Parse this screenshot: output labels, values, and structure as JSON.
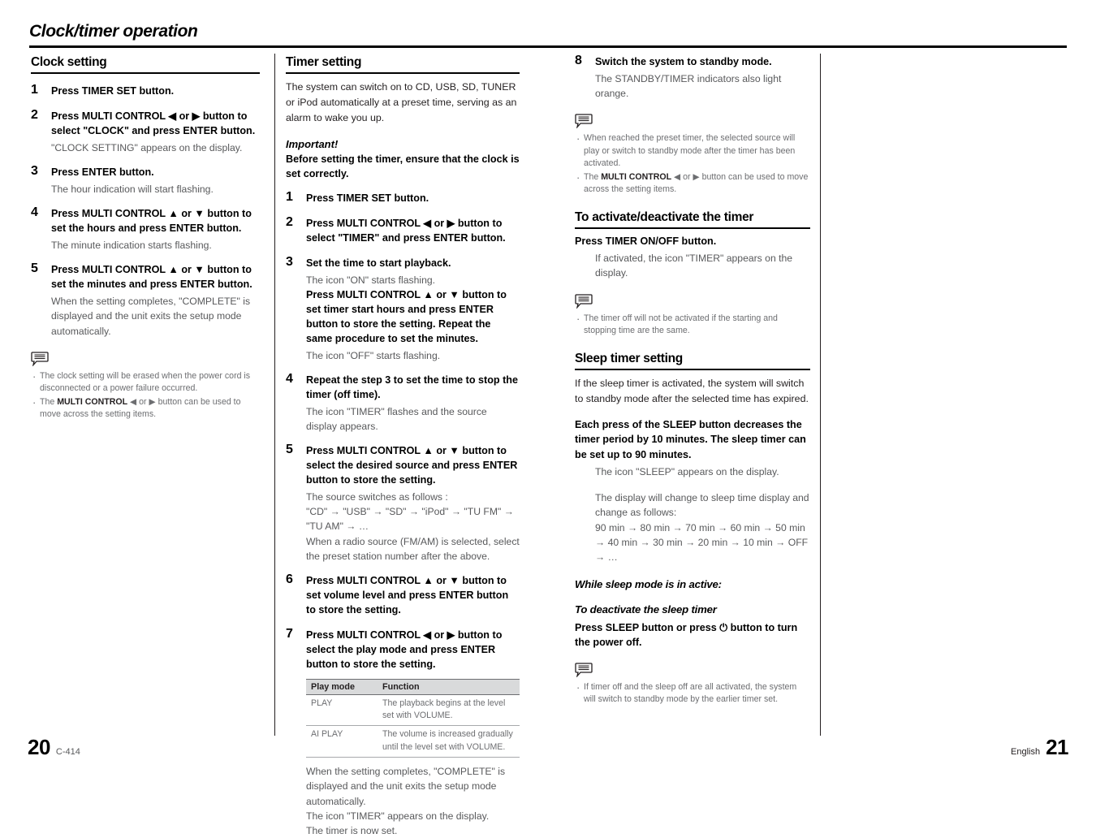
{
  "running_head": "Clock/timer operation",
  "footer": {
    "left_page": "20",
    "model": "C-414",
    "language": "English",
    "right_page": "21"
  },
  "left_column": {
    "heading": "Clock setting",
    "steps": [
      {
        "num": "1",
        "title": "Press TIMER SET button.",
        "body": ""
      },
      {
        "num": "2",
        "title": "Press MULTI CONTROL ◀ or ▶ button to select \"CLOCK\" and press ENTER button.",
        "body": "\"CLOCK SETTING\" appears on the display."
      },
      {
        "num": "3",
        "title": "Press ENTER button.",
        "body": "The hour indication will start flashing."
      },
      {
        "num": "4",
        "title": "Press MULTI CONTROL ▲ or ▼ button to set the hours and press ENTER button.",
        "body": "The minute indication starts flashing."
      },
      {
        "num": "5",
        "title": "Press MULTI CONTROL ▲ or ▼ button to set the minutes and press ENTER button.",
        "body": "When the setting completes, \"COMPLETE\" is displayed and the unit exits the setup mode automatically."
      }
    ],
    "notes": [
      "The clock setting will be erased when the power cord is disconnected or a power failure occurred.",
      "The MULTI CONTROL ◀ or ▶ button can be used to move across the setting items."
    ],
    "note2_prefix": "The ",
    "note2_bold": "MULTI CONTROL",
    "note2_mid": " ◀ or ▶ ",
    "note2_suffix": "button can be used to move across the setting items."
  },
  "middle_column": {
    "heading": "Timer setting",
    "intro": "The system can switch on to CD, USB, SD, TUNER or iPod automatically at a preset time, serving as an alarm to wake you up.",
    "important_label": "Important!",
    "important_text": "Before setting the timer, ensure that the clock is set correctly.",
    "steps": [
      {
        "num": "1",
        "title": "Press TIMER SET button.",
        "body": ""
      },
      {
        "num": "2",
        "title": "Press MULTI CONTROL ◀ or ▶ button to select \"TIMER\" and press ENTER button.",
        "body": ""
      },
      {
        "num": "3",
        "title": "Set the time to start playback.",
        "body": "The icon \"ON\" starts flashing.",
        "sub_bold": "Press MULTI CONTROL ▲ or ▼ button to set timer start hours and press ENTER button to store the setting. Repeat the same procedure to set the minutes.",
        "body2": "The icon \"OFF\" starts flashing."
      },
      {
        "num": "4",
        "title": "Repeat the step 3 to set the time to stop the timer (off time).",
        "body": "The icon \"TIMER\" flashes and the source display appears."
      },
      {
        "num": "5",
        "title": "Press MULTI CONTROL ▲ or ▼ button to select the desired source and press ENTER button to store the setting.",
        "body": "The source switches as follows :",
        "body_line2": "\"CD\" → \"USB\" →  \"SD\" → \"iPod\" → \"TU FM\" → \"TU AM\" → …",
        "body_line3": "When a radio source (FM/AM) is selected, select the preset station number after the above."
      },
      {
        "num": "6",
        "title": "Press MULTI CONTROL ▲ or ▼ button to set volume level and press ENTER button to store the setting.",
        "body": ""
      },
      {
        "num": "7",
        "title": "Press MULTI CONTROL ◀ or ▶ button to select the play mode and press ENTER button to store the setting.",
        "body": ""
      }
    ],
    "table": {
      "headers": [
        "Play mode",
        "Function"
      ],
      "rows": [
        [
          "PLAY",
          "The playback begins at the level set with VOLUME."
        ],
        [
          "AI PLAY",
          "The volume is increased gradually until the level set with VOLUME."
        ]
      ]
    },
    "after_table": [
      "When the setting completes, \"COMPLETE\" is displayed and the unit exits the setup mode automatically.",
      "The icon \"TIMER\" appears on the display.",
      "The timer is now set."
    ]
  },
  "right_column": {
    "step8": {
      "num": "8",
      "title": "Switch the system to standby mode.",
      "body": "The STANDBY/TIMER indicators also light orange."
    },
    "notes1": [
      "When reached the preset timer, the selected source will play or switch to standby mode after the timer has been activated."
    ],
    "note1_2_prefix": "The ",
    "note1_2_bold": "MULTI CONTROL",
    "note1_2_mid": " ◀ or ▶ ",
    "note1_2_suffix": "button can be used to move across the setting items.",
    "activate": {
      "heading": "To activate/deactivate the timer",
      "bold_line": "Press TIMER ON/OFF button.",
      "body": "If activated, the icon \"TIMER\" appears on the display.",
      "note": "The timer off will not be activated if the starting and stopping time are the same."
    },
    "sleep": {
      "heading": "Sleep timer setting",
      "intro": "If the sleep timer is activated, the system will switch to standby mode after the selected time has expired.",
      "bold_line": "Each press of the SLEEP button decreases the timer period by 10 minutes. The sleep timer can be set up to 90 minutes.",
      "body1": "The icon \"SLEEP\" appears on the display.",
      "body2": "The display will change to sleep time display and change as follows:",
      "sequence_line1": "90 min → 80 min → 70 min → 60 min → 50 min",
      "sequence_line2": "→ 40 min → 30 min → 20 min → 10 min → OFF",
      "sequence_line3": "→ …",
      "while_active": "While sleep mode is in active:",
      "deactivate_heading": "To deactivate the sleep timer",
      "deactivate_text_a": "Press SLEEP button or press ",
      "deactivate_symbol": "⏻",
      "deactivate_text_b": " button to turn the power off.",
      "note": "If timer off and the sleep off are all activated, the system will switch to standby mode by the earlier timer set."
    }
  }
}
